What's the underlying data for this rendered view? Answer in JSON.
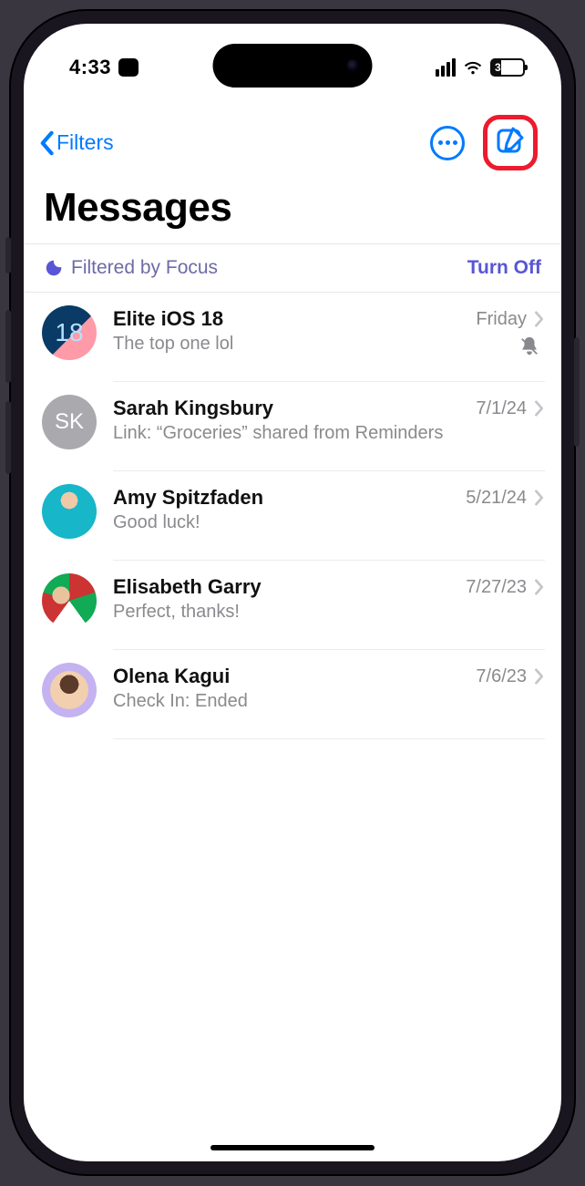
{
  "status": {
    "time": "4:33",
    "battery_pct": "30"
  },
  "nav": {
    "back_label": "Filters"
  },
  "title": "Messages",
  "focus": {
    "label": "Filtered by Focus",
    "action": "Turn Off"
  },
  "conversations": [
    {
      "name": "Elite iOS 18",
      "date": "Friday",
      "preview": "The top one lol",
      "muted": true,
      "avatar_text": "18",
      "initials": ""
    },
    {
      "name": "Sarah Kingsbury",
      "date": "7/1/24",
      "preview": "Link: “Groceries” shared from Reminders",
      "muted": false,
      "avatar_text": "",
      "initials": "SK"
    },
    {
      "name": "Amy Spitzfaden",
      "date": "5/21/24",
      "preview": "Good luck!",
      "muted": false,
      "avatar_text": "",
      "initials": ""
    },
    {
      "name": "Elisabeth Garry",
      "date": "7/27/23",
      "preview": "Perfect, thanks!",
      "muted": false,
      "avatar_text": "",
      "initials": ""
    },
    {
      "name": "Olena Kagui",
      "date": "7/6/23",
      "preview": "Check In: Ended",
      "muted": false,
      "avatar_text": "",
      "initials": ""
    }
  ]
}
